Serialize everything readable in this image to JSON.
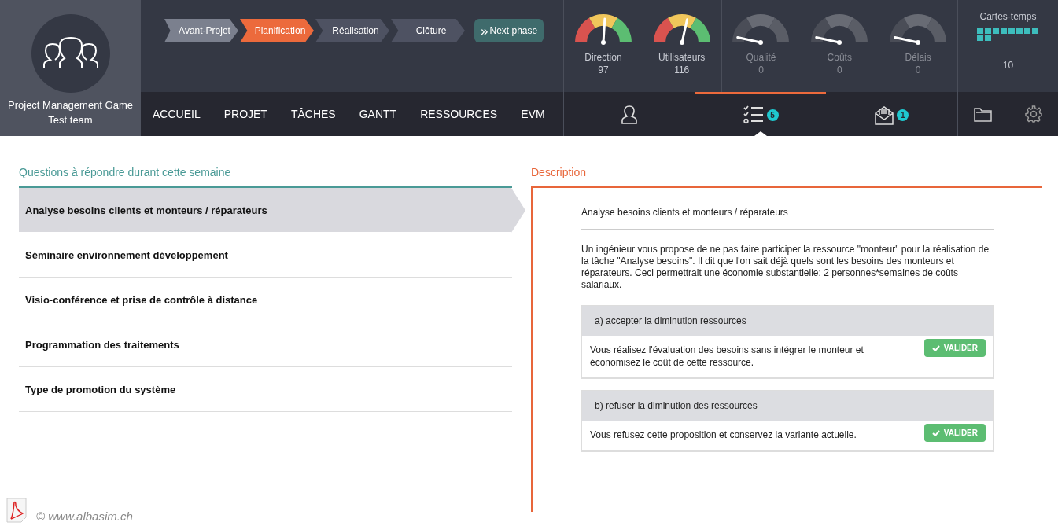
{
  "brand": {
    "title": "Project Management Game",
    "team": "Test team"
  },
  "phases": [
    {
      "label": "Avant-Projet",
      "kind": "done"
    },
    {
      "label": "Planification",
      "kind": "current"
    },
    {
      "label": "Réalisation",
      "kind": "upcoming"
    },
    {
      "label": "Clôture",
      "kind": "upcoming"
    }
  ],
  "next_phase": {
    "icon": "»",
    "label": "Next phase"
  },
  "menu": [
    {
      "label": "ACCUEIL"
    },
    {
      "label": "PROJET"
    },
    {
      "label": "TÂCHES"
    },
    {
      "label": "GANTT"
    },
    {
      "label": "RESSOURCES"
    },
    {
      "label": "EVM"
    }
  ],
  "gauges": [
    {
      "label": "Direction",
      "value": "97",
      "level": 0.52,
      "disabled": false
    },
    {
      "label": "Utilisateurs",
      "value": "116",
      "level": 0.57,
      "disabled": false
    },
    {
      "label": "Qualité",
      "value": "0",
      "level": 0.07,
      "disabled": true
    },
    {
      "label": "Coûts",
      "value": "0",
      "level": 0.07,
      "disabled": true
    },
    {
      "label": "Délais",
      "value": "0",
      "level": 0.07,
      "disabled": true
    }
  ],
  "time_cards": {
    "label": "Cartes-temps",
    "value": "10"
  },
  "tabs": [
    {
      "kind": "person",
      "selected": false
    },
    {
      "kind": "tasks",
      "selected": true,
      "badge": "5"
    },
    {
      "kind": "mail",
      "selected": false,
      "badge": "1"
    }
  ],
  "questions": {
    "title": "Questions à répondre durant cette semaine",
    "items": [
      {
        "label": "Analyse besoins clients et monteurs / réparateurs",
        "selected": true
      },
      {
        "label": "Séminaire environnement développement",
        "selected": false
      },
      {
        "label": "Visio-conférence et prise de contrôle à distance",
        "selected": false
      },
      {
        "label": "Programmation des traitements",
        "selected": false
      },
      {
        "label": "Type de promotion du système",
        "selected": false
      }
    ]
  },
  "description": {
    "title": "Description",
    "heading": "Analyse besoins clients et monteurs / réparateurs",
    "text": "Un ingénieur vous propose de ne pas faire participer la ressource \"monteur\" pour la réalisation de la tâche \"Analyse besoins\". Il dit que l'on sait déjà quels sont les besoins des monteurs et réparateurs. Ceci permettrait une économie substantielle: 2 personnes*semaines de coûts salariaux.",
    "options": [
      {
        "title": "a) accepter la diminution ressources",
        "text": "Vous réalisez l'évaluation des besoins sans intégrer le monteur et économisez le coût de cette ressource.",
        "button": "VALIDER"
      },
      {
        "title": "b) refuser la diminution des ressources",
        "text": "Vous refusez cette proposition et conservez la variante actuelle.",
        "button": "VALIDER"
      }
    ]
  },
  "footer": {
    "copyright": "© www.albasim.ch"
  }
}
